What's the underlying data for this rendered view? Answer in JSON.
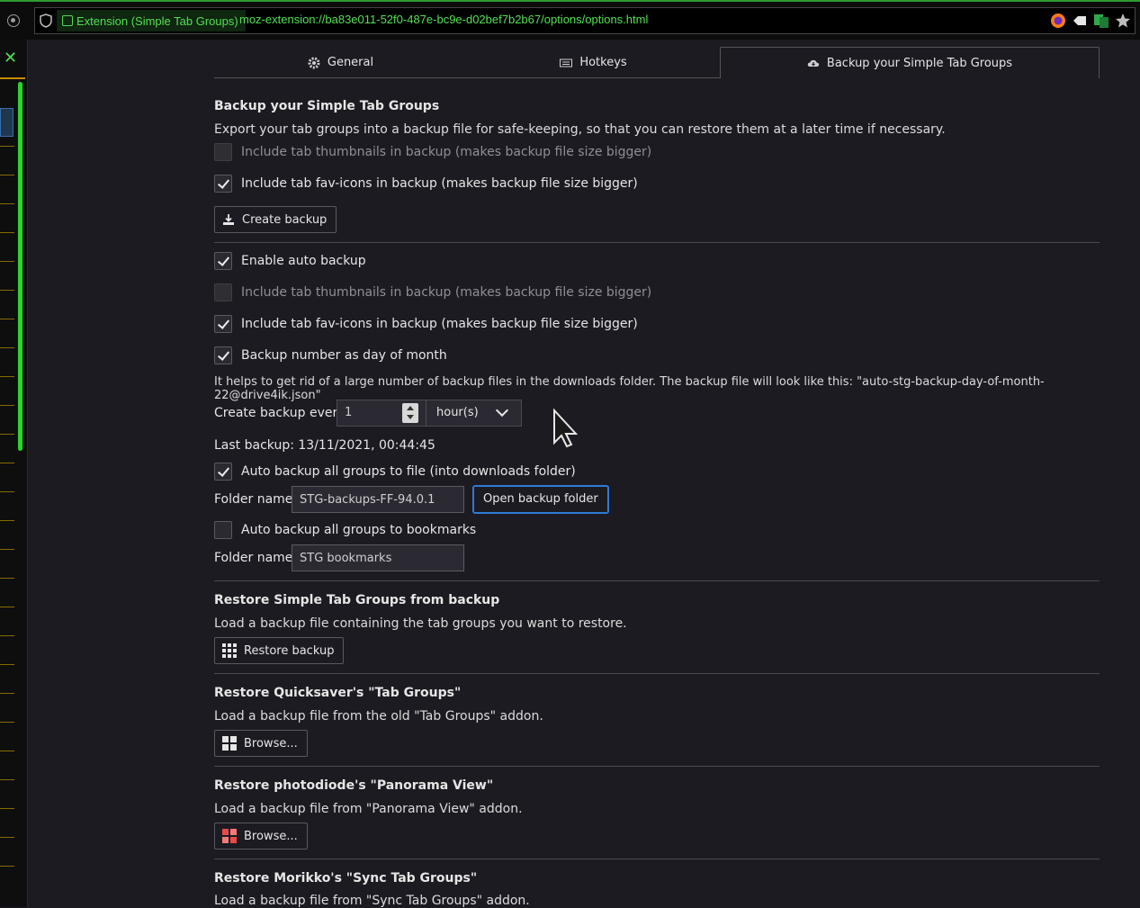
{
  "browser": {
    "extension_chip": "Extension (Simple Tab Groups)",
    "url": "moz-extension://ba83e011-52f0-487e-bc9e-d02bef7b2b67/options/options.html"
  },
  "tabs": [
    {
      "label": "General",
      "icon": "gear-icon"
    },
    {
      "label": "Hotkeys",
      "icon": "keyboard-icon"
    },
    {
      "label": "Backup your Simple Tab Groups",
      "icon": "cloud-download-icon",
      "active": true
    }
  ],
  "backup": {
    "title": "Backup your Simple Tab Groups",
    "description": "Export your tab groups into a backup file for safe-keeping, so that you can restore them at a later time if necessary.",
    "include_thumbnails": "Include tab thumbnails in backup (makes backup file size bigger)",
    "include_favicons": "Include tab fav-icons in backup (makes backup file size bigger)",
    "create_button": "Create backup"
  },
  "auto": {
    "enable": "Enable auto backup",
    "include_thumbnails": "Include tab thumbnails in backup (makes backup file size bigger)",
    "include_favicons": "Include tab fav-icons in backup (makes backup file size bigger)",
    "day_of_month": "Backup number as day of month",
    "hint": "It helps to get rid of a large number of backup files in the downloads folder. The backup file will look like this: \"auto-stg-backup-day-of-month-22@drive4ik.json\"",
    "every_label": "Create backup every:",
    "every_value": "1",
    "every_unit": "hour(s)",
    "last_backup": "Last backup: 13/11/2021, 00:44:45",
    "to_file": "Auto backup all groups to file (into downloads folder)",
    "folder_label": "Folder name:",
    "folder_value": "STG-backups-FF-94.0.1",
    "open_folder": "Open backup folder",
    "to_bookmarks": "Auto backup all groups to bookmarks",
    "bm_folder_label": "Folder name:",
    "bm_folder_value": "STG bookmarks"
  },
  "restore": {
    "title": "Restore Simple Tab Groups from backup",
    "description": "Load a backup file containing the tab groups you want to restore.",
    "button": "Restore backup"
  },
  "quicksaver": {
    "title": "Restore Quicksaver's \"Tab Groups\"",
    "description": "Load a backup file from the old \"Tab Groups\" addon.",
    "button": "Browse..."
  },
  "panorama": {
    "title": "Restore photodiode's \"Panorama View\"",
    "description": "Load a backup file from \"Panorama View\" addon.",
    "button": "Browse..."
  },
  "sync": {
    "title": "Restore Morikko's \"Sync Tab Groups\"",
    "description": "Load a backup file from \"Sync Tab Groups\" addon."
  },
  "colors": {
    "accent_green": "#52e052",
    "focus_blue": "#2f7bd6",
    "background": "#1c1b22"
  }
}
